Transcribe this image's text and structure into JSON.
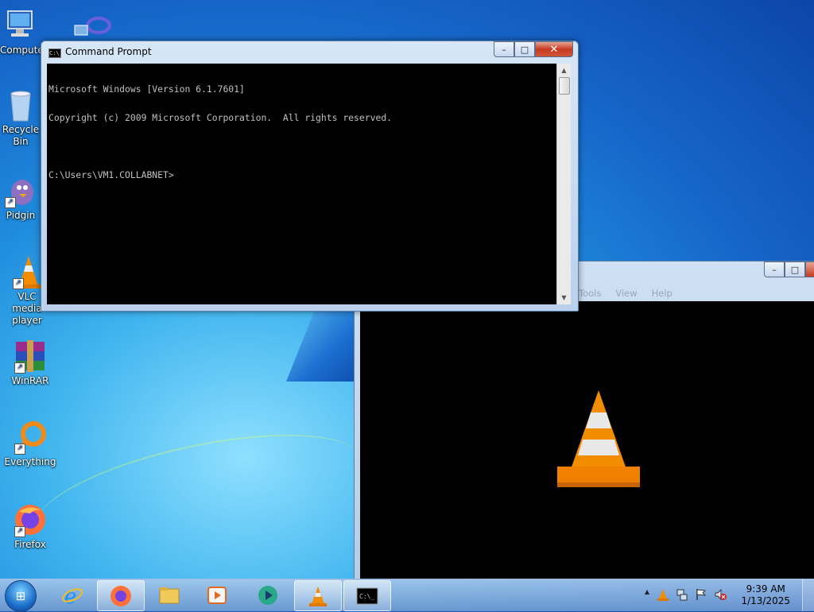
{
  "desktop": {
    "icons": [
      {
        "label": "Computer",
        "name": "computer"
      },
      {
        "label": "",
        "name": "network"
      },
      {
        "label": "Recycle Bin",
        "name": "recycle-bin"
      },
      {
        "label": "Pidgin",
        "name": "pidgin"
      },
      {
        "label": "VLC media player",
        "name": "vlc"
      },
      {
        "label": "WinRAR",
        "name": "winrar"
      },
      {
        "label": "Everything",
        "name": "everything"
      },
      {
        "label": "Firefox",
        "name": "firefox"
      }
    ]
  },
  "cmd": {
    "title": "Command Prompt",
    "icon_label": "C:\\_",
    "lines": [
      "Microsoft Windows [Version 6.1.7601]",
      "Copyright (c) 2009 Microsoft Corporation.  All rights reserved.",
      "",
      "C:\\Users\\VM1.COLLABNET>"
    ],
    "buttons": {
      "minimize": "–",
      "maximize": "□",
      "close": "✕"
    }
  },
  "vlc": {
    "menu": [
      "Tools",
      "View",
      "Help"
    ],
    "buttons": {
      "minimize": "–",
      "maximize": "□"
    }
  },
  "taskbar": {
    "start_label": "⊞",
    "apps": [
      "internet-explorer",
      "firefox",
      "file-explorer",
      "media-player",
      "app-circle",
      "vlc",
      "command-prompt"
    ],
    "clock_time": "9:39 AM",
    "clock_date": "1/13/2025",
    "tray_expand": "▲"
  },
  "colors": {
    "vlc_orange": "#f28c00",
    "cmd_text": "#c0c0c0"
  }
}
